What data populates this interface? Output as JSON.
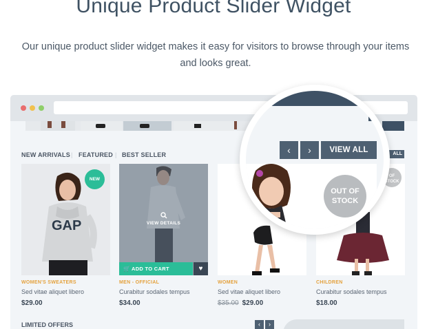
{
  "hero": {
    "title": "Unique Product Slider Widget",
    "subtitle": "Our unique product slider widget makes it easy for visitors to browse through your items and looks great."
  },
  "colors": {
    "accent": "#2bbd98",
    "dark": "#3a4654",
    "category": "#e4a13c",
    "nav": "#4e6072"
  },
  "browser_dots": [
    "#e96e6e",
    "#f1c14f",
    "#8fcf6a"
  ],
  "tabs": {
    "new_arrivals": "NEW ARRIVALS",
    "featured": "FEATURED",
    "best_seller": "BEST SELLER",
    "separator": "|"
  },
  "zoom": {
    "prev_icon": "chevron-left-icon",
    "next_icon": "chevron-right-icon",
    "prev": "‹",
    "next": "›",
    "view_all": "VIEW ALL"
  },
  "behind_view_all": "ALL",
  "products": [
    {
      "category": "WOMEN'S SWEATERS",
      "name": "Sed vitae aliquet libero",
      "price": "$29.00",
      "old_price": "",
      "badge": "NEW"
    },
    {
      "category": "MEN - OFFICIAL",
      "name": "Curabitur sodales tempus",
      "price": "$34.00",
      "old_price": "",
      "hover_label": "VIEW DETAILS",
      "add_to_cart": "ADD TO CART"
    },
    {
      "category": "WOMEN",
      "name": "Sed vitae aliquet libero",
      "price": "$29.00",
      "old_price": "$35.00"
    },
    {
      "category": "CHILDREN",
      "name": "Curabitur sodales tempus",
      "price": "$18.00",
      "old_price": "",
      "badge_partial": "OF STOCK"
    }
  ],
  "out_of_stock": {
    "line1": "OUT OF",
    "line2": "STOCK"
  },
  "limited": {
    "title": "LIMITED OFFERS",
    "prev": "‹",
    "next": "›"
  }
}
